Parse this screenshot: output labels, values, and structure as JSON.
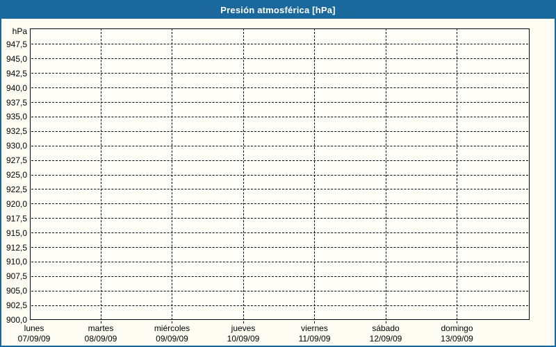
{
  "window": {
    "title": "Presión atmosférica [hPa]"
  },
  "colors": {
    "titlebar_bg": "#1a689c",
    "frame_border": "#17679a",
    "title_text": "#ffffff",
    "grid_color": "#000000",
    "label_color": "#000000",
    "plot_bg": "#fffef6"
  },
  "chart_data": {
    "type": "line",
    "title": "Presión atmosférica [hPa]",
    "ylabel": "hPa",
    "xlabel": "",
    "grid": "dashed",
    "legend_position": "none",
    "ylim": [
      900.0,
      950.0
    ],
    "y_tick_step": 2.5,
    "y_tick_labels": [
      "947,5",
      "945,0",
      "942,5",
      "940,0",
      "937,5",
      "935,0",
      "932,5",
      "930,0",
      "927,5",
      "925,0",
      "922,5",
      "920,0",
      "917,5",
      "915,0",
      "912,5",
      "910,0",
      "907,5",
      "905,0",
      "902,5",
      "900,0"
    ],
    "unit_label": "hPa",
    "x_days": [
      {
        "name": "lunes",
        "date": "07/09/09"
      },
      {
        "name": "martes",
        "date": "08/09/09"
      },
      {
        "name": "miércoles",
        "date": "09/09/09"
      },
      {
        "name": "jueves",
        "date": "10/09/09"
      },
      {
        "name": "viernes",
        "date": "11/09/09"
      },
      {
        "name": "sábado",
        "date": "12/09/09"
      },
      {
        "name": "domingo",
        "date": "13/09/09"
      }
    ],
    "series": []
  }
}
